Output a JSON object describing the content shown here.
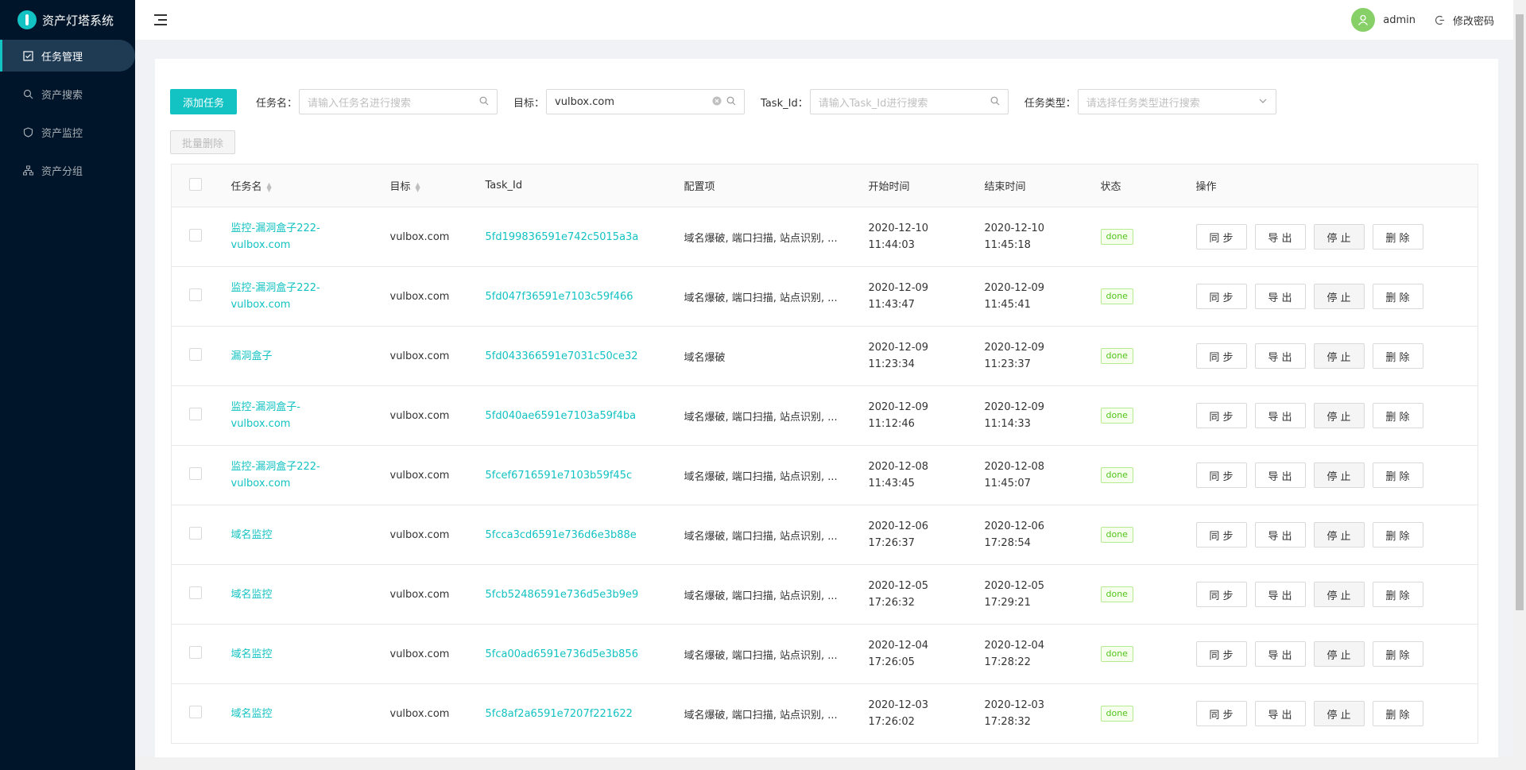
{
  "app": {
    "title": "资产灯塔系统"
  },
  "sidebar": {
    "items": [
      {
        "label": "任务管理",
        "icon": "task-icon",
        "active": true
      },
      {
        "label": "资产搜索",
        "icon": "search-icon",
        "active": false
      },
      {
        "label": "资产监控",
        "icon": "shield-icon",
        "active": false
      },
      {
        "label": "资产分组",
        "icon": "cluster-icon",
        "active": false
      }
    ]
  },
  "header": {
    "user": "admin",
    "change_password": "修改密码"
  },
  "toolbar": {
    "add_task": "添加任务",
    "batch_delete": "批量删除",
    "task_name_label": "任务名：",
    "task_name_placeholder": "请输入任务名进行搜索",
    "target_label": "目标：",
    "target_value": "vulbox.com",
    "task_id_label": "Task_Id：",
    "task_id_placeholder": "请输入Task_Id进行搜索",
    "task_type_label": "任务类型：",
    "task_type_placeholder": "请选择任务类型进行搜索"
  },
  "table": {
    "columns": [
      "任务名",
      "目标",
      "Task_Id",
      "配置项",
      "开始时间",
      "结束时间",
      "状态",
      "操作"
    ],
    "actions": [
      "同 步",
      "导 出",
      "停 止",
      "删 除"
    ],
    "rows": [
      {
        "name": "监控-漏洞盒子222-vulbox.com",
        "target": "vulbox.com",
        "task_id": "5fd199836591e742c5015a3a",
        "config": "域名爆破, 端口扫描, 站点识别, ...",
        "start": "2020-12-10 11:44:03",
        "end": "2020-12-10 11:45:18",
        "status": "done"
      },
      {
        "name": "监控-漏洞盒子222-vulbox.com",
        "target": "vulbox.com",
        "task_id": "5fd047f36591e7103c59f466",
        "config": "域名爆破, 端口扫描, 站点识别, ...",
        "start": "2020-12-09 11:43:47",
        "end": "2020-12-09 11:45:41",
        "status": "done"
      },
      {
        "name": "漏洞盒子",
        "target": "vulbox.com",
        "task_id": "5fd043366591e7031c50ce32",
        "config": "域名爆破",
        "start": "2020-12-09 11:23:34",
        "end": "2020-12-09 11:23:37",
        "status": "done"
      },
      {
        "name": "监控-漏洞盒子-vulbox.com",
        "target": "vulbox.com",
        "task_id": "5fd040ae6591e7103a59f4ba",
        "config": "域名爆破, 端口扫描, 站点识别, ...",
        "start": "2020-12-09 11:12:46",
        "end": "2020-12-09 11:14:33",
        "status": "done"
      },
      {
        "name": "监控-漏洞盒子222-vulbox.com",
        "target": "vulbox.com",
        "task_id": "5fcef6716591e7103b59f45c",
        "config": "域名爆破, 端口扫描, 站点识别, ...",
        "start": "2020-12-08 11:43:45",
        "end": "2020-12-08 11:45:07",
        "status": "done"
      },
      {
        "name": "域名监控",
        "target": "vulbox.com",
        "task_id": "5fcca3cd6591e736d6e3b88e",
        "config": "域名爆破, 端口扫描, 站点识别, ...",
        "start": "2020-12-06 17:26:37",
        "end": "2020-12-06 17:28:54",
        "status": "done"
      },
      {
        "name": "域名监控",
        "target": "vulbox.com",
        "task_id": "5fcb52486591e736d5e3b9e9",
        "config": "域名爆破, 端口扫描, 站点识别, ...",
        "start": "2020-12-05 17:26:32",
        "end": "2020-12-05 17:29:21",
        "status": "done"
      },
      {
        "name": "域名监控",
        "target": "vulbox.com",
        "task_id": "5fca00ad6591e736d5e3b856",
        "config": "域名爆破, 端口扫描, 站点识别, ...",
        "start": "2020-12-04 17:26:05",
        "end": "2020-12-04 17:28:22",
        "status": "done"
      },
      {
        "name": "域名监控",
        "target": "vulbox.com",
        "task_id": "5fc8af2a6591e7207f221622",
        "config": "域名爆破, 端口扫描, 站点识别, ...",
        "start": "2020-12-03 17:26:02",
        "end": "2020-12-03 17:28:32",
        "status": "done"
      }
    ]
  }
}
